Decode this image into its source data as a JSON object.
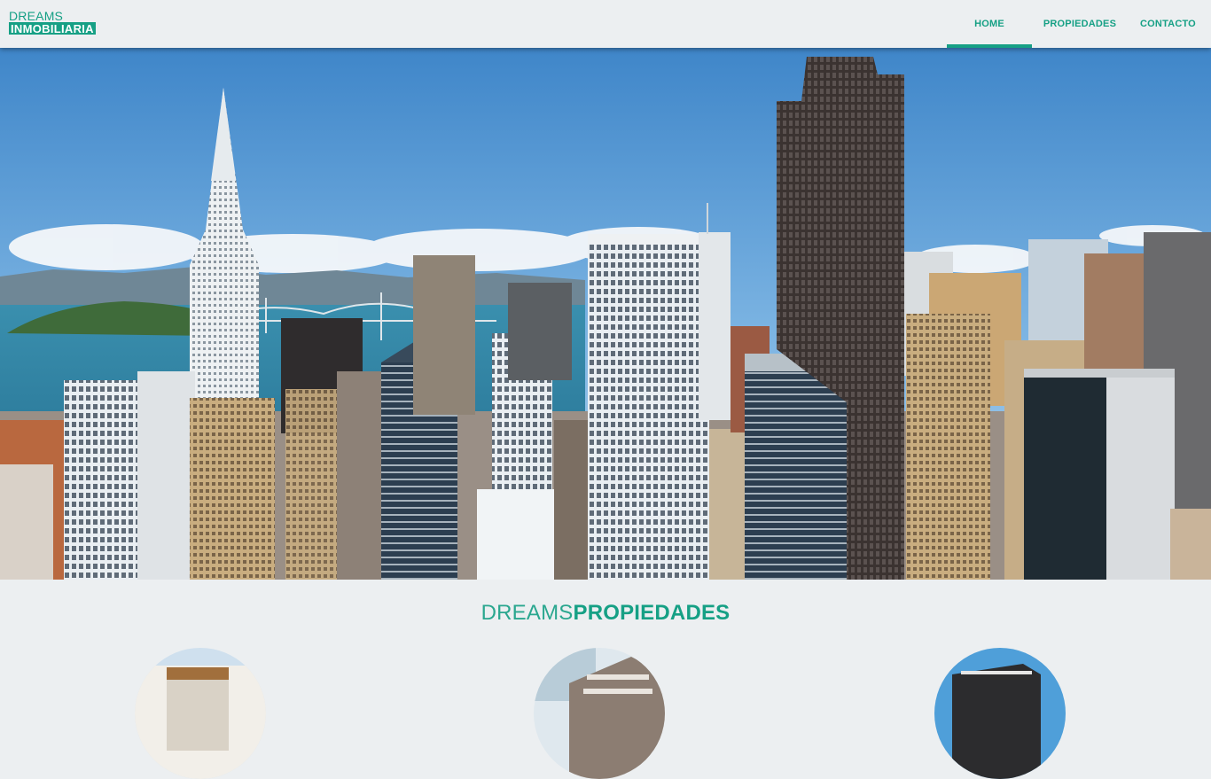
{
  "brand": {
    "line1": "DREAMS",
    "line2": "INMOBILIARIA"
  },
  "nav": {
    "items": [
      {
        "label": "HOME",
        "active": true
      },
      {
        "label": "PROPIEDADES",
        "active": false
      },
      {
        "label": "CONTACTO",
        "active": false
      }
    ]
  },
  "hero": {
    "image": "city-skyline-photo",
    "slides": 3,
    "active_slide": 1
  },
  "section": {
    "title_light": "DREAMS",
    "title_bold": "PROPIEDADES"
  },
  "properties": [
    {
      "image": "property-photo-1"
    },
    {
      "image": "property-photo-2"
    },
    {
      "image": "property-photo-3"
    }
  ],
  "colors": {
    "accent": "#16a085",
    "background": "#eceff1"
  }
}
